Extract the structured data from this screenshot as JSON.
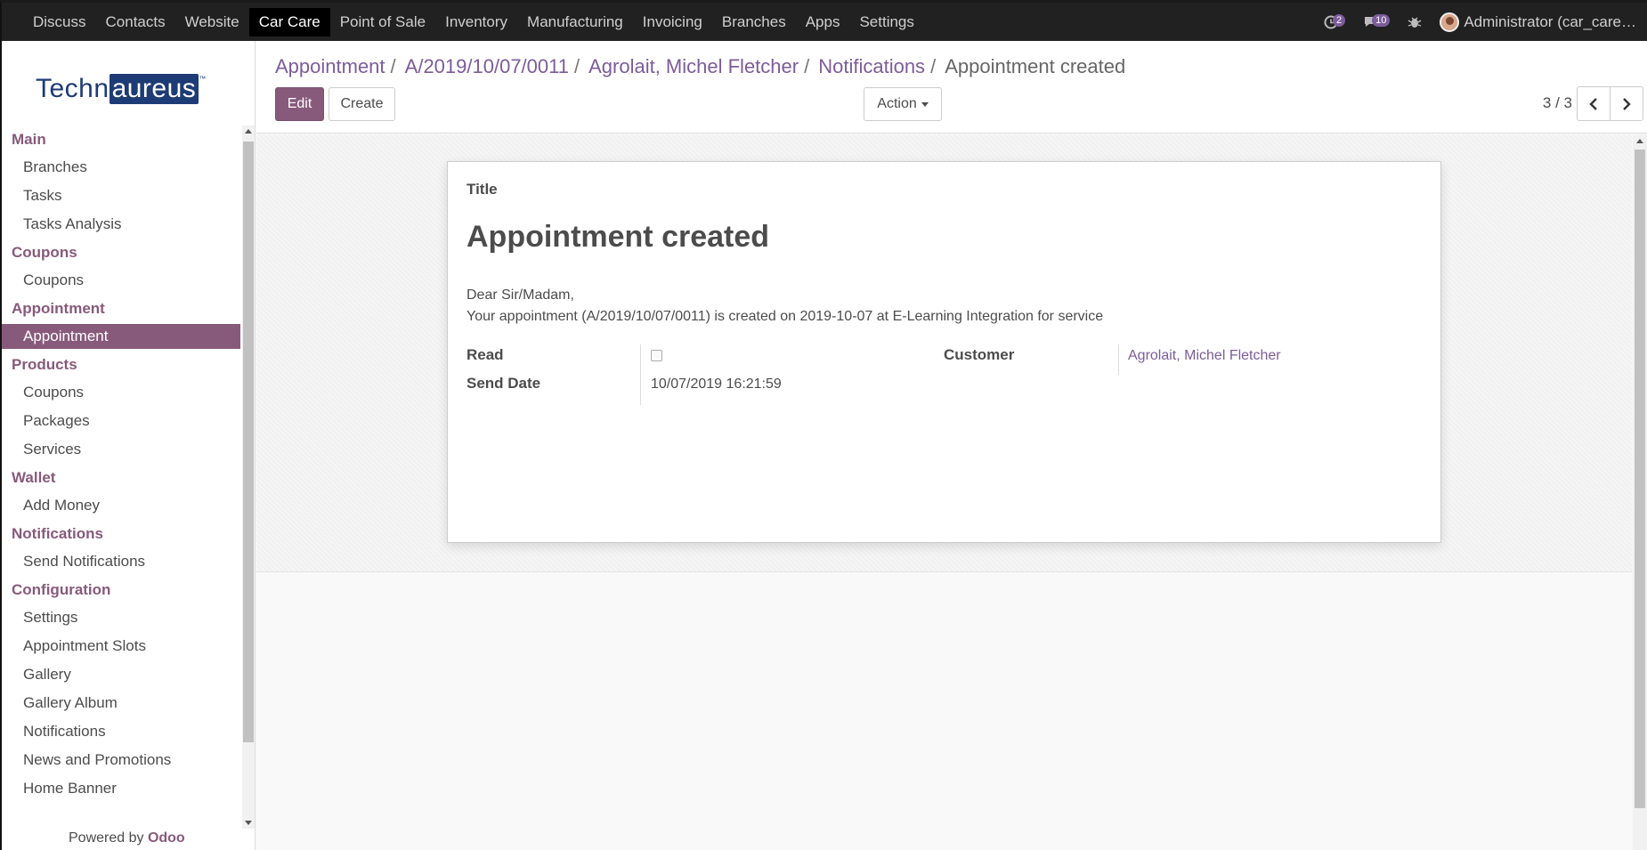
{
  "topbar": {
    "menu": [
      {
        "label": "Discuss",
        "active": false
      },
      {
        "label": "Contacts",
        "active": false
      },
      {
        "label": "Website",
        "active": false
      },
      {
        "label": "Car Care",
        "active": true
      },
      {
        "label": "Point of Sale",
        "active": false
      },
      {
        "label": "Inventory",
        "active": false
      },
      {
        "label": "Manufacturing",
        "active": false
      },
      {
        "label": "Invoicing",
        "active": false
      },
      {
        "label": "Branches",
        "active": false
      },
      {
        "label": "Apps",
        "active": false
      },
      {
        "label": "Settings",
        "active": false
      }
    ],
    "activity_count": "2",
    "messages_count": "10",
    "user_label": "Administrator (car_care…"
  },
  "sidebar": {
    "logo": {
      "part1": "Techn",
      "part2": "aureus",
      "tm": "™"
    },
    "sections": [
      {
        "title": "Main",
        "items": [
          "Branches",
          "Tasks",
          "Tasks Analysis"
        ]
      },
      {
        "title": "Coupons",
        "items": [
          "Coupons"
        ]
      },
      {
        "title": "Appointment",
        "items": [
          "Appointment"
        ]
      },
      {
        "title": "Products",
        "items": [
          "Coupons",
          "Packages",
          "Services"
        ]
      },
      {
        "title": "Wallet",
        "items": [
          "Add Money"
        ]
      },
      {
        "title": "Notifications",
        "items": [
          "Send Notifications"
        ]
      },
      {
        "title": "Configuration",
        "items": [
          "Settings",
          "Appointment Slots",
          "Gallery",
          "Gallery Album",
          "Notifications",
          "News and Promotions",
          "Home Banner"
        ]
      }
    ],
    "active_item": "Appointment",
    "powered_prefix": "Powered by ",
    "powered_brand": "Odoo"
  },
  "control": {
    "breadcrumbs": [
      "Appointment",
      "A/2019/10/07/0011",
      "Agrolait, Michel Fletcher",
      "Notifications"
    ],
    "current": "Appointment created",
    "edit_label": "Edit",
    "create_label": "Create",
    "action_label": "Action",
    "pager": "3 / 3"
  },
  "form": {
    "title_label": "Title",
    "title_value": "Appointment created",
    "message_line1": "Dear Sir/Madam,",
    "message_line2": "Your appointment (A/2019/10/07/0011) is created on 2019-10-07 at E-Learning Integration for service",
    "read_label": "Read",
    "read_value": false,
    "send_date_label": "Send Date",
    "send_date_value": "10/07/2019 16:21:59",
    "customer_label": "Customer",
    "customer_value": "Agrolait, Michel Fletcher"
  },
  "icons": {
    "activity": "clock-icon",
    "messages": "chat-bubble-icon",
    "debug": "bug-icon",
    "prev": "chevron-left-icon",
    "next": "chevron-right-icon"
  }
}
